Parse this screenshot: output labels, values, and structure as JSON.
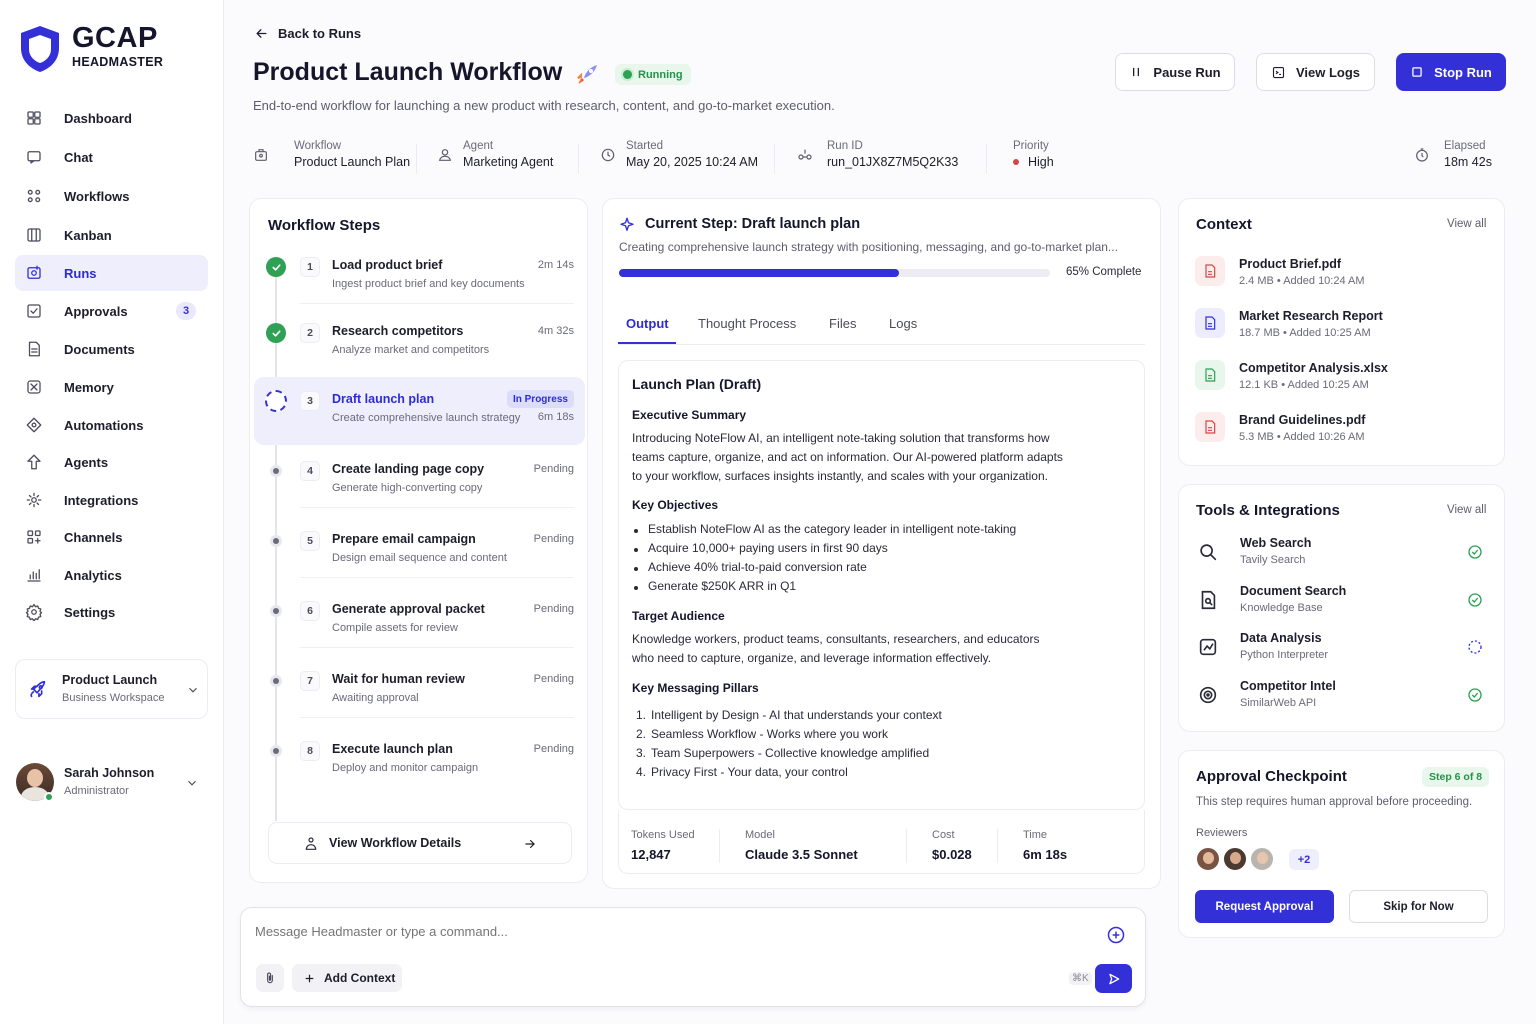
{
  "brand": {
    "name": "GCAP",
    "sub": "HEADMASTER"
  },
  "colors": {
    "accent": "#3330d8",
    "success": "#2ea154",
    "danger": "#d64545",
    "text": "#15152b"
  },
  "nav": [
    {
      "label": "Dashboard",
      "icon": "dashboard-icon"
    },
    {
      "label": "Chat",
      "icon": "chat-icon"
    },
    {
      "label": "Workflows",
      "icon": "workflows-icon"
    },
    {
      "label": "Kanban",
      "icon": "kanban-icon"
    },
    {
      "label": "Runs",
      "icon": "runs-icon",
      "active": true
    },
    {
      "label": "Approvals",
      "icon": "approvals-icon",
      "badge": "3"
    },
    {
      "label": "Documents",
      "icon": "documents-icon"
    },
    {
      "label": "Memory",
      "icon": "memory-icon"
    },
    {
      "label": "Automations",
      "icon": "automations-icon"
    },
    {
      "label": "Agents",
      "icon": "agents-icon"
    },
    {
      "label": "Integrations",
      "icon": "integrations-icon"
    },
    {
      "label": "Channels",
      "icon": "channels-icon"
    },
    {
      "label": "Analytics",
      "icon": "analytics-icon"
    },
    {
      "label": "Settings",
      "icon": "settings-icon"
    }
  ],
  "workspace": {
    "name": "Product Launch",
    "type": "Business Workspace"
  },
  "user": {
    "name": "Sarah Johnson",
    "role": "Administrator"
  },
  "header": {
    "back": "Back to Runs",
    "title": "Product Launch Workflow",
    "status": "Running",
    "description": "End-to-end workflow for launching a new product with research, content, and go-to-market execution.",
    "pause": "Pause Run",
    "logs": "View Logs",
    "stop": "Stop Run"
  },
  "meta": {
    "workflow": {
      "label": "Workflow",
      "value": "Product Launch Plan"
    },
    "agent": {
      "label": "Agent",
      "value": "Marketing Agent"
    },
    "started": {
      "label": "Started",
      "value": "May 20, 2025 10:24 AM"
    },
    "run_id": {
      "label": "Run ID",
      "value": "run_01JX8Z7M5Q2K33"
    },
    "priority": {
      "label": "Priority",
      "value": "High"
    },
    "elapsed": {
      "label": "Elapsed",
      "value": "18m 42s"
    }
  },
  "steps": {
    "title": "Workflow Steps",
    "items": [
      {
        "num": "1",
        "title": "Load product brief",
        "sub": "Ingest product brief and key documents",
        "time": "2m 14s",
        "state": "done"
      },
      {
        "num": "2",
        "title": "Research competitors",
        "sub": "Analyze market and competitors",
        "time": "4m 32s",
        "state": "done"
      },
      {
        "num": "3",
        "title": "Draft launch plan",
        "sub": "Create comprehensive launch strategy",
        "time": "6m 18s",
        "state": "active",
        "badge": "In Progress"
      },
      {
        "num": "4",
        "title": "Create landing page copy",
        "sub": "Generate high-converting copy",
        "time": "Pending",
        "state": "pending"
      },
      {
        "num": "5",
        "title": "Prepare email campaign",
        "sub": "Design email sequence and content",
        "time": "Pending",
        "state": "pending"
      },
      {
        "num": "6",
        "title": "Generate approval packet",
        "sub": "Compile assets for review",
        "time": "Pending",
        "state": "pending"
      },
      {
        "num": "7",
        "title": "Wait for human review",
        "sub": "Awaiting approval",
        "time": "Pending",
        "state": "pending"
      },
      {
        "num": "8",
        "title": "Execute launch plan",
        "sub": "Deploy and monitor campaign",
        "time": "Pending",
        "state": "pending"
      }
    ],
    "details_button": "View Workflow Details"
  },
  "current": {
    "title": "Current Step: Draft launch plan",
    "desc": "Creating comprehensive launch strategy with positioning, messaging, and go-to-market plan...",
    "progress": 0.65,
    "progress_label": "65% Complete",
    "tabs": [
      "Output",
      "Thought Process",
      "Files",
      "Logs"
    ],
    "doc": {
      "title": "Launch Plan (Draft)",
      "exec_h": "Executive Summary",
      "exec_lines": [
        "Introducing NoteFlow AI, an intelligent note-taking solution that transforms how",
        "teams capture, organize, and act on information. Our AI-powered platform adapts",
        "to your workflow, surfaces insights instantly, and scales with your organization."
      ],
      "obj_h": "Key Objectives",
      "objectives": [
        "Establish NoteFlow AI as the category leader in intelligent note-taking",
        "Acquire 10,000+ paying users in first 90 days",
        "Achieve 40% trial-to-paid conversion rate",
        "Generate $250K ARR in Q1"
      ],
      "aud_h": "Target Audience",
      "aud_lines": [
        "Knowledge workers, product teams, consultants, researchers, and educators",
        "who need to capture, organize, and leverage information effectively."
      ],
      "pill_h": "Key Messaging Pillars",
      "pillars": [
        "Intelligent by Design - AI that understands your context",
        "Seamless Workflow - Works where you work",
        "Team Superpowers - Collective knowledge amplified",
        "Privacy First - Your data, your control"
      ]
    },
    "stats": [
      {
        "label": "Tokens Used",
        "value": "12,847"
      },
      {
        "label": "Model",
        "value": "Claude 3.5 Sonnet"
      },
      {
        "label": "Cost",
        "value": "$0.028"
      },
      {
        "label": "Time",
        "value": "6m 18s"
      }
    ]
  },
  "composer": {
    "placeholder": "Message Headmaster or type a command...",
    "add_context": "Add Context",
    "shortcut": "⌘K"
  },
  "context": {
    "title": "Context",
    "view_all": "View all",
    "files": [
      {
        "name": "Product Brief.pdf",
        "meta": "2.4 MB • Added 10:24 AM",
        "kind": "pdf"
      },
      {
        "name": "Market Research Report",
        "meta": "18.7 MB • Added 10:25 AM",
        "kind": "doc"
      },
      {
        "name": "Competitor Analysis.xlsx",
        "meta": "12.1 KB • Added 10:25 AM",
        "kind": "sheet"
      },
      {
        "name": "Brand Guidelines.pdf",
        "meta": "5.3 MB • Added 10:26 AM",
        "kind": "pdf"
      }
    ]
  },
  "tools": {
    "title": "Tools & Integrations",
    "view_all": "View all",
    "items": [
      {
        "name": "Web Search",
        "sub": "Tavily Search",
        "icon": "search-icon",
        "state": "ok"
      },
      {
        "name": "Document Search",
        "sub": "Knowledge Base",
        "icon": "document-search-icon",
        "state": "ok"
      },
      {
        "name": "Data Analysis",
        "sub": "Python Interpreter",
        "icon": "data-analysis-icon",
        "state": "loading"
      },
      {
        "name": "Competitor Intel",
        "sub": "SimilarWeb API",
        "icon": "competitor-intel-icon",
        "state": "ok"
      }
    ]
  },
  "approval": {
    "title": "Approval Checkpoint",
    "step": "Step 6 of 8",
    "desc": "This step requires human approval before proceeding.",
    "reviewers_label": "Reviewers",
    "more": "+2",
    "request": "Request Approval",
    "skip": "Skip for Now"
  }
}
